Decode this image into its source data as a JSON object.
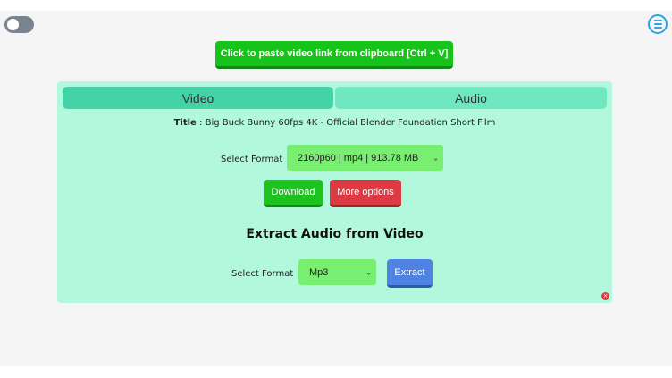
{
  "header": {
    "paste_label": "Click to paste video link from clipboard [Ctrl + V]"
  },
  "panel": {
    "tabs": [
      {
        "label": "Video"
      },
      {
        "label": "Audio"
      }
    ],
    "title_label": "Title",
    "title_value": "Big Buck Bunny 60fps 4K - Official Blender Foundation Short Film",
    "video": {
      "format_label": "Select Format",
      "format_selected": "2160p60 | mp4 | 913.78 MB",
      "download_label": "Download",
      "more_options_label": "More options"
    },
    "audio": {
      "heading": "Extract Audio from Video",
      "format_label": "Select Format",
      "format_selected": "Mp3",
      "extract_label": "Extract"
    }
  },
  "colors": {
    "panel_bg": "#b2f8dd",
    "tab_active": "#43d3a6",
    "tab_inactive": "#6fe8c2",
    "green_button": "#17c31a",
    "red_button": "#dc3b43",
    "blue_button": "#4e83e4"
  },
  "icons": {
    "menu": "menu-icon",
    "close": "close-icon",
    "chevron": "chevron-down-icon"
  }
}
